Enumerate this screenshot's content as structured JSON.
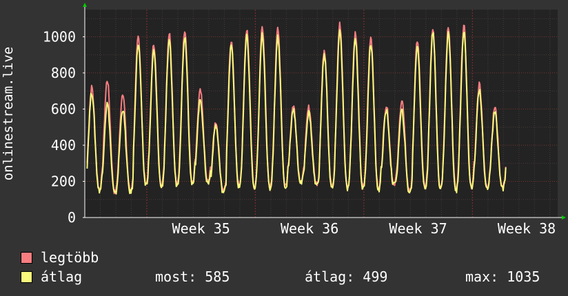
{
  "chart_data": {
    "type": "line",
    "ylabel": "onlinestream.live",
    "yticks": [
      "0",
      "200",
      "400",
      "600",
      "800",
      "1000"
    ],
    "ylim": [
      0,
      1150
    ],
    "xticks": [
      {
        "label": "Week 35",
        "day": 7.5
      },
      {
        "label": "Week 36",
        "day": 14.5
      },
      {
        "label": "Week 37",
        "day": 21.5
      },
      {
        "label": "Week 38",
        "day": 28.5
      }
    ],
    "xlim_days": [
      0,
      30.5
    ],
    "grid": true,
    "colors": {
      "background": "#333333",
      "plot": "#232323",
      "grid_minor": "#5a4040",
      "grid_major": "#8a3030",
      "axis": "#ffffff",
      "arrow": "#00cc00"
    },
    "series": [
      {
        "name": "legtöbb",
        "color": "#f87d80",
        "daily_peaks": [
          720,
          760,
          690,
          1000,
          960,
          1020,
          1040,
          700,
          530,
          980,
          1040,
          1050,
          1040,
          620,
          610,
          930,
          1070,
          1020,
          1000,
          620,
          650,
          980,
          1050,
          1050,
          1060,
          740,
          610
        ],
        "daily_troughs": [
          160,
          140,
          150,
          190,
          180,
          190,
          190,
          200,
          150,
          180,
          170,
          170,
          170,
          200,
          190,
          170,
          170,
          170,
          160,
          190,
          150,
          170,
          170,
          160,
          170,
          170,
          170
        ]
      },
      {
        "name": "átlag",
        "color": "#f8f87c",
        "daily_peaks": [
          690,
          630,
          600,
          960,
          920,
          970,
          1000,
          650,
          510,
          950,
          1000,
          1010,
          1000,
          600,
          580,
          900,
          1030,
          990,
          960,
          590,
          590,
          950,
          1020,
          1020,
          1030,
          710,
          580
        ],
        "daily_troughs": [
          150,
          130,
          140,
          180,
          170,
          180,
          180,
          190,
          140,
          170,
          160,
          160,
          160,
          190,
          180,
          160,
          160,
          160,
          150,
          180,
          140,
          160,
          160,
          150,
          160,
          160,
          160
        ]
      }
    ]
  },
  "legend": {
    "items": [
      {
        "label": "legtöbb",
        "color": "#f87d80"
      },
      {
        "label": "átlag",
        "color": "#f8f87c"
      }
    ],
    "stats": {
      "most": "most: 585",
      "atlag": "átlag: 499",
      "max": "max: 1035"
    }
  }
}
